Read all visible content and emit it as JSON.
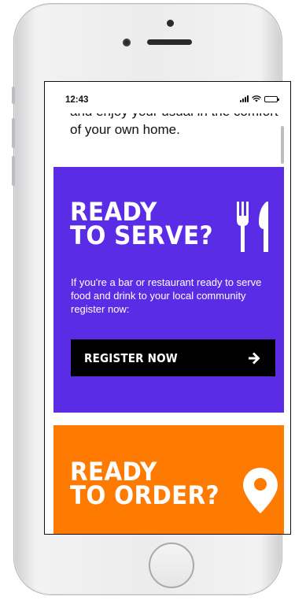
{
  "status_bar": {
    "time": "12:43"
  },
  "intro": {
    "text": "and enjoy your usual in the comfort of your own home."
  },
  "serve_card": {
    "title_line1": "READY",
    "title_line2": "TO SERVE?",
    "icon": "cutlery-icon",
    "description": "If you're a bar or restaurant ready to serve food and drink to your local community register now:",
    "button_label": "REGISTER NOW",
    "button_icon": "arrow-right-icon",
    "color": "#5b2ce6"
  },
  "order_card": {
    "title_line1": "READY",
    "title_line2": "TO ORDER?",
    "icon": "location-pin-icon",
    "color": "#ff7a00"
  },
  "colors": {
    "button_bg": "#000000",
    "text_on_card": "#ffffff"
  }
}
